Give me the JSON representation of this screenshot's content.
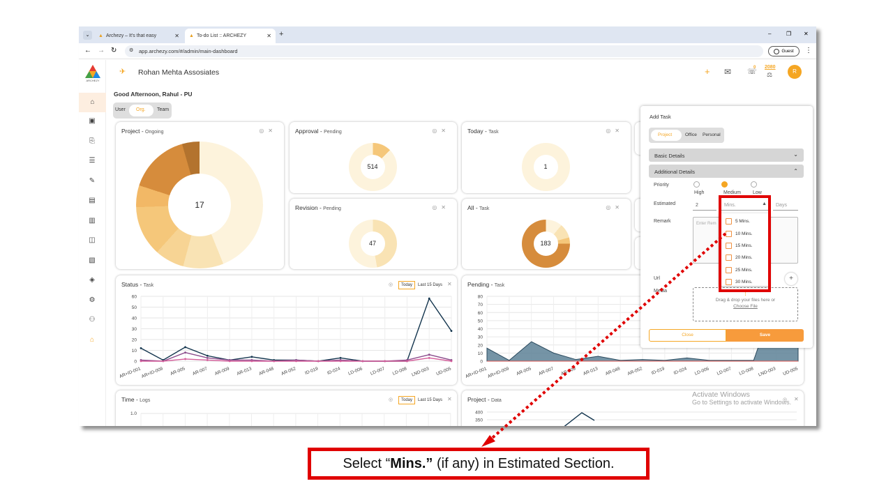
{
  "browser": {
    "tabs": [
      {
        "label": "Archezy – It's that easy"
      },
      {
        "label": "To-do List :: ARCHEZY"
      }
    ],
    "new_tab": "+",
    "url": "app.archezy.com/#/admin/main-dashboard",
    "guest_label": "Guest",
    "window_controls": [
      "–",
      "❐",
      "✕"
    ]
  },
  "header": {
    "logo_text": "ARCHEZY",
    "org_name": "Rohan Mehta Assosiates",
    "points": "2080",
    "notif_count": "0",
    "avatar": "R",
    "accent": "#f5a623"
  },
  "greeting": "Good Afternoon, Rahul - PU",
  "view_toggle": {
    "options": [
      "User",
      "Org.",
      "Team"
    ],
    "selected": "Org."
  },
  "cards": {
    "project": {
      "title": "Project",
      "sub": "Ongoing",
      "value": "17"
    },
    "approval": {
      "title": "Approval",
      "sub": "Pending",
      "value": "514"
    },
    "today": {
      "title": "Today",
      "sub": "Task",
      "value": "1"
    },
    "revision": {
      "title": "Revision",
      "sub": "Pending",
      "value": "47"
    },
    "all": {
      "title": "All",
      "sub": "Task",
      "value": "183"
    },
    "status": {
      "title": "Status",
      "sub": "Task",
      "btn_today": "Today",
      "btn_last": "Last 15 Days"
    },
    "pending": {
      "title": "Pending",
      "sub": "Task"
    },
    "time": {
      "title": "Time",
      "sub": "Logs",
      "btn_today": "Today",
      "btn_last": "Last 15 Days"
    },
    "projdata": {
      "title": "Project",
      "sub": "Data"
    }
  },
  "chart_data": [
    {
      "type": "line",
      "title": "Status - Task",
      "categories": [
        "AR+ID-001",
        "AR+ID-009",
        "AR-005",
        "AR-007",
        "AR-009",
        "AR-013",
        "AR-048",
        "AR-052",
        "ID-019",
        "ID-024",
        "LD-006",
        "LD-007",
        "LD-008",
        "LND-003",
        "UD-005"
      ],
      "ylim": [
        0,
        60
      ],
      "yticks": [
        "0",
        "10",
        "20",
        "30",
        "40",
        "50",
        "60"
      ],
      "series": [
        {
          "values": [
            12,
            1,
            13,
            5,
            1,
            4,
            1,
            1,
            0,
            3,
            0,
            0,
            0,
            58,
            28
          ],
          "color": "#12344d"
        },
        {
          "values": [
            1,
            0,
            8,
            3,
            1,
            1,
            0,
            1,
            0,
            1,
            0,
            0,
            1,
            6,
            1
          ],
          "color": "#8b4c8c"
        },
        {
          "values": [
            0,
            0,
            2,
            1,
            0,
            0,
            0,
            0,
            0,
            0,
            0,
            0,
            0,
            3,
            0
          ],
          "color": "#d45d9a"
        }
      ]
    },
    {
      "type": "area",
      "title": "Pending - Task",
      "categories": [
        "AR+ID-001",
        "AR+ID-009",
        "AR-005",
        "AR-007",
        "AR-009",
        "AR-013",
        "AR-048",
        "AR-052",
        "ID-019",
        "ID-024",
        "LD-006",
        "LD-007",
        "LD-008",
        "LND-003",
        "UD-005"
      ],
      "ylim": [
        0,
        80
      ],
      "yticks": [
        "0",
        "10",
        "20",
        "30",
        "40",
        "50",
        "60",
        "70",
        "80"
      ],
      "values": [
        16,
        1,
        24,
        10,
        2,
        6,
        1,
        2,
        1,
        4,
        1,
        1,
        1,
        80,
        80
      ],
      "color": "#5d8196"
    },
    {
      "type": "line",
      "title": "Time - Logs",
      "yticks": [
        "1.0"
      ]
    },
    {
      "type": "line",
      "title": "Project - Data",
      "yticks": [
        "400",
        "350"
      ]
    }
  ],
  "add_task": {
    "title": "Add Task",
    "types": [
      "Project",
      "Office",
      "Personal"
    ],
    "selected_type": "Project",
    "basic": "Basic Details",
    "additional": "Additional Details",
    "priority_label": "Priority",
    "priorities": [
      "High",
      "Medium",
      "Low"
    ],
    "selected_priority": "Medium",
    "estimated_label": "Estimated",
    "estimated_value": "2",
    "unit_placeholder": "Mins.",
    "days_placeholder": "Days",
    "remark_label": "Remark",
    "remark_placeholder": "Enter Rem",
    "url_label": "Url",
    "media_label": "Media",
    "drop_text": "Drag & drop your files here or",
    "choose_file": "Choose File",
    "close": "Close",
    "save": "Save",
    "dropdown_options": [
      "5 Mins.",
      "10 Mins.",
      "15 Mins.",
      "20 Mins.",
      "25 Mins.",
      "30 Mins."
    ]
  },
  "watermark": {
    "line1": "Activate Windows",
    "line2": "Go to Settings to activate Windows."
  },
  "callout": {
    "pre": "Select “",
    "bold": "Mins.”",
    "post": " (if any) in Estimated Section."
  }
}
